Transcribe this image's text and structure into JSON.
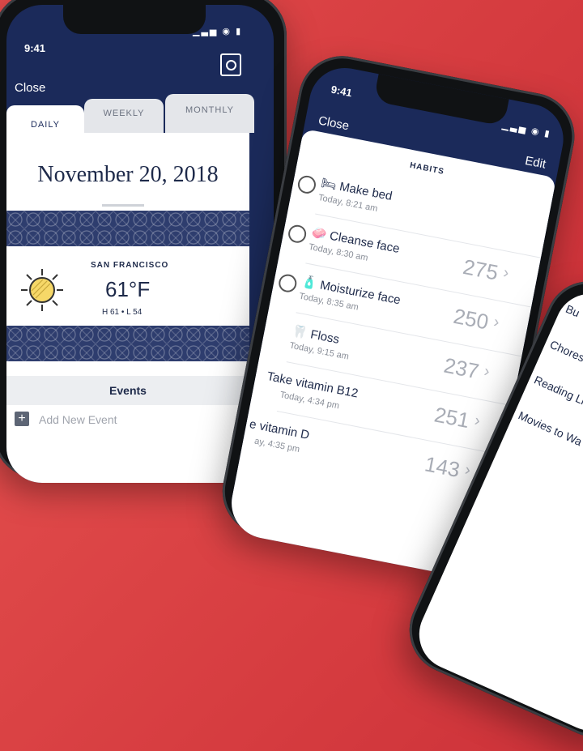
{
  "phone1": {
    "status_time": "9:41",
    "status_icons": "▁▃▅ ◉ ▮",
    "close_label": "Close",
    "tabs": [
      {
        "label": "DAILY",
        "active": true
      },
      {
        "label": "WEEKLY",
        "active": false
      },
      {
        "label": "MONTHLY",
        "active": false
      }
    ],
    "date": "November 20, 2018",
    "weather": {
      "city": "SAN FRANCISCO",
      "temp": "61°F",
      "hilo": "H 61 • L 54",
      "icon": "sun-icon"
    },
    "events_title": "Events",
    "add_event_label": "Add New Event"
  },
  "phone2": {
    "status_time": "9:41",
    "status_icons": "▁▃▅ ◉ ▮",
    "close_label": "Close",
    "header": "HABITS",
    "edit_label": "Edit",
    "habits": [
      {
        "emoji": "🛏",
        "name": "Make bed",
        "time": "Today, 8:21 am",
        "count": ""
      },
      {
        "emoji": "🧼",
        "name": "Cleanse face",
        "time": "Today, 8:30 am",
        "count": "275"
      },
      {
        "emoji": "🧴",
        "name": "Moisturize face",
        "time": "Today, 8:35 am",
        "count": "250"
      },
      {
        "emoji": "🦷",
        "name": "Floss",
        "time": "Today, 9:15 am",
        "count": "237"
      },
      {
        "emoji": "",
        "name": "Take vitamin B12",
        "time": "Today, 4:34 pm",
        "count": "251"
      },
      {
        "emoji": "",
        "name": "e vitamin D",
        "time": "ay, 4:35 pm",
        "count": "143"
      }
    ]
  },
  "phone3": {
    "items": [
      "Bu",
      "Chores",
      "Reading List",
      "Movies to Wa"
    ]
  }
}
